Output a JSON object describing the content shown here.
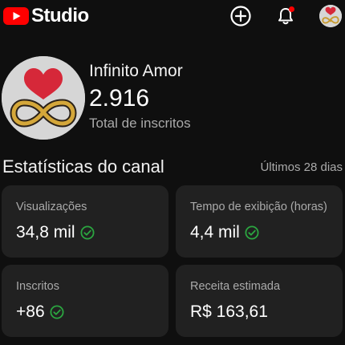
{
  "app": {
    "logo_text": "Studio",
    "icons": {
      "create": "add-circle-icon",
      "notifications": "bell-icon",
      "account": "account-avatar"
    },
    "colors": {
      "background": "#0f0f0f",
      "card": "#212121",
      "brand_red": "#ff0000",
      "check_green": "#2ba640"
    }
  },
  "channel": {
    "name": "Infinito Amor",
    "subscribers": "2.916",
    "subscribers_label": "Total de inscritos"
  },
  "stats": {
    "title": "Estatísticas do canal",
    "period": "Últimos 28 dias",
    "cards": [
      {
        "label": "Visualizações",
        "value": "34,8 mil",
        "check": true
      },
      {
        "label": "Tempo de exibição (horas)",
        "value": "4,4 mil",
        "check": true
      },
      {
        "label": "Inscritos",
        "value": "+86",
        "check": true
      },
      {
        "label": "Receita estimada",
        "value": "R$ 163,61",
        "check": false
      }
    ]
  }
}
